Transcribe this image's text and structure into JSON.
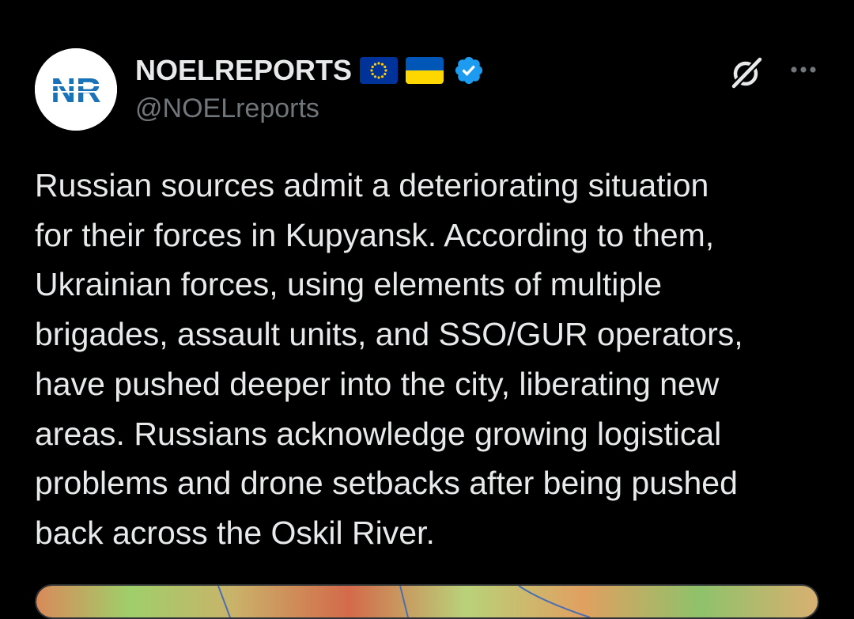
{
  "tweet": {
    "display_name": "NOELREPORTS",
    "handle": "@NOELreports",
    "avatar_text": "NR",
    "badges": [
      "eu-flag-icon",
      "ukraine-flag-icon",
      "verified-badge-icon"
    ],
    "text_lines": [
      "Russian sources admit a deteriorating situation",
      "for their forces in Kupyansk. According to them,",
      "Ukrainian forces, using elements of multiple",
      "brigades, assault units, and SSO/GUR operators,",
      "have pushed deeper into the city, liberating new",
      "areas. Russians acknowledge growing logistical",
      "problems and drone setbacks after being pushed",
      "back across the Oskil River."
    ]
  },
  "header_actions": {
    "grok_icon": "grok-icon",
    "more_icon": "more-dots-icon"
  },
  "colors": {
    "background": "#000000",
    "text_primary": "#e7e9ea",
    "text_secondary": "#71767b",
    "verified_blue": "#1d9bf0",
    "brand_blue": "#1a73b8",
    "eu_blue": "#003399",
    "eu_star": "#ffcc00",
    "ua_blue": "#0057b7",
    "ua_yellow": "#ffd700"
  }
}
